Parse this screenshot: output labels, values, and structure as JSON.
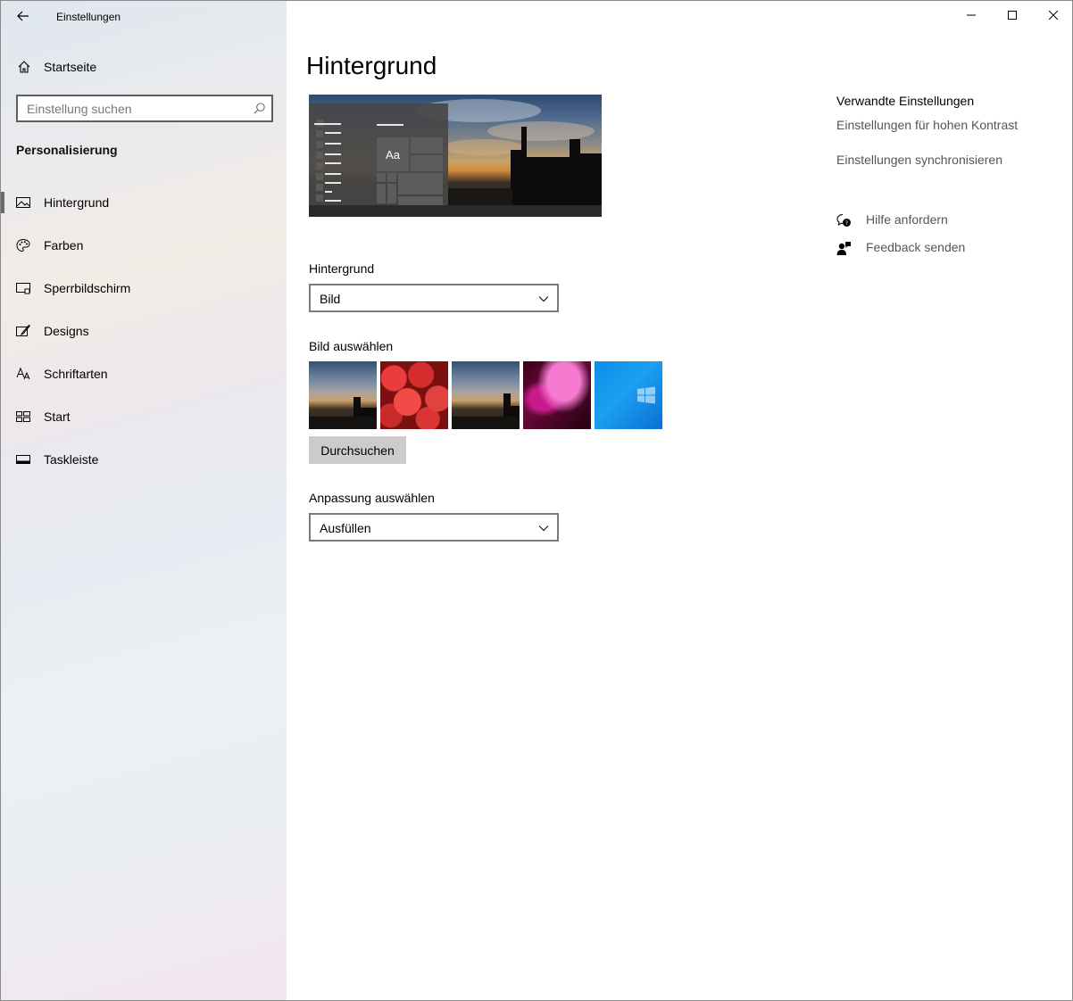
{
  "window": {
    "app_title": "Einstellungen",
    "caption": {
      "minimize": "minimize-icon",
      "maximize": "maximize-icon",
      "close": "close-icon"
    }
  },
  "sidebar": {
    "home_label": "Startseite",
    "search_placeholder": "Einstellung suchen",
    "section_title": "Personalisierung",
    "items": [
      {
        "label": "Hintergrund",
        "icon": "picture-icon",
        "active": true
      },
      {
        "label": "Farben",
        "icon": "palette-icon",
        "active": false
      },
      {
        "label": "Sperrbildschirm",
        "icon": "lockscreen-icon",
        "active": false
      },
      {
        "label": "Designs",
        "icon": "designs-icon",
        "active": false
      },
      {
        "label": "Schriftarten",
        "icon": "fonts-icon",
        "active": false
      },
      {
        "label": "Start",
        "icon": "start-icon",
        "active": false
      },
      {
        "label": "Taskleiste",
        "icon": "taskbar-icon",
        "active": false
      }
    ]
  },
  "main": {
    "title": "Hintergrund",
    "preview": {
      "tile_text": "Aa"
    },
    "background_label": "Hintergrund",
    "background_value": "Bild",
    "choose_picture_label": "Bild auswählen",
    "browse_label": "Durchsuchen",
    "fit_label": "Anpassung auswählen",
    "fit_value": "Ausfüllen"
  },
  "related": {
    "heading": "Verwandte Einstellungen",
    "links": [
      "Einstellungen für hohen Kontrast",
      "Einstellungen synchronisieren"
    ]
  },
  "help": {
    "get_help": "Hilfe anfordern",
    "feedback": "Feedback senden"
  },
  "colors": {
    "accent": "#6b6b6b",
    "button_bg": "#cccccc",
    "link_text": "#555555"
  }
}
